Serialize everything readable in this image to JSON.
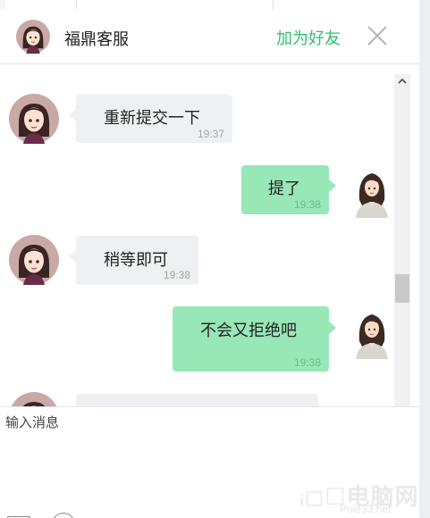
{
  "header": {
    "contact_name": "福鼎客服",
    "add_friend_label": "加为好友"
  },
  "messages": [
    {
      "side": "recv",
      "text": "重新提交一下",
      "time": "19:37"
    },
    {
      "side": "sent",
      "text": "提了",
      "time": "19:38"
    },
    {
      "side": "recv",
      "text": "稍等即可",
      "time": "19:38"
    },
    {
      "side": "sent",
      "text": "不会又拒绝吧",
      "time": "19:38"
    }
  ],
  "composer": {
    "placeholder": "输入消息"
  },
  "watermark": {
    "main": "ᵢ◻☐电脑网",
    "sub": "Pole33.net"
  },
  "colors": {
    "accent": "#2fbf71",
    "sent_bubble": "#98e7b7",
    "recv_bubble": "#eef0f3"
  }
}
